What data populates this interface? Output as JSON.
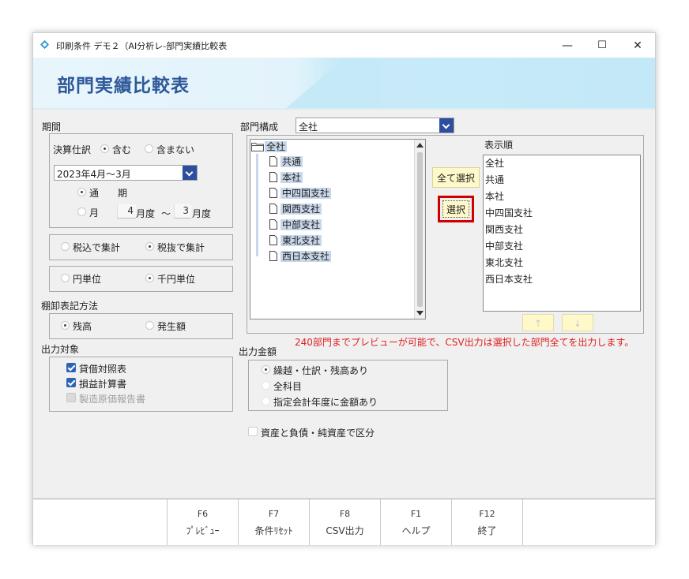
{
  "window": {
    "title": "印刷条件 デモ２（AI分析レ-部門実績比較表",
    "minimize": "—",
    "maximize": "☐",
    "close": "✕"
  },
  "banner": {
    "title": "部門実績比較表"
  },
  "period": {
    "heading": "期間",
    "settlement_label": "決算仕訳",
    "include": "含む",
    "exclude": "含まない",
    "period_value": "2023年4月～3月",
    "mode_full": "通　　期",
    "mode_month": "月",
    "from_month": "4",
    "from_unit": "月度",
    "tilde": "～",
    "to_month": "3",
    "to_unit": "月度"
  },
  "tax": {
    "incl": "税込で集計",
    "excl": "税抜で集計"
  },
  "unit": {
    "yen": "円単位",
    "thousand": "千円単位"
  },
  "inventory": {
    "heading": "棚卸表記方法",
    "balance": "残高",
    "occurrence": "発生額"
  },
  "output_target": {
    "heading": "出力対象",
    "items": [
      "貸借対照表",
      "損益計算書",
      "製造原価報告書"
    ]
  },
  "dept": {
    "label": "部門構成",
    "select_value": "全社",
    "tree_root": "全社",
    "tree_items": [
      "共通",
      "本社",
      "中四国支社",
      "関西支社",
      "中部支社",
      "東北支社",
      "西日本支社"
    ],
    "select_all": "全て選択",
    "select": "選択",
    "order_label": "表示順",
    "order_items": [
      "全社",
      "共通",
      "本社",
      "中四国支社",
      "関西支社",
      "中部支社",
      "東北支社",
      "西日本支社"
    ],
    "up": "↑",
    "down": "↓",
    "notice": "240部門までプレビューが可能で、CSV出力は選択した部門全てを出力します。"
  },
  "amount": {
    "heading": "出力金額",
    "options": [
      "繰越・仕訳・残高あり",
      "全科目",
      "指定会計年度に金額あり"
    ]
  },
  "asset_split": "資産と負債・純資産で区分",
  "fkeys": [
    {
      "key": "F6",
      "name": "ﾌﾟﾚﾋﾞｭｰ"
    },
    {
      "key": "F7",
      "name": "条件ﾘｾｯﾄ"
    },
    {
      "key": "F8",
      "name": "CSV出力"
    },
    {
      "key": "F1",
      "name": "ヘルプ"
    },
    {
      "key": "F12",
      "name": "終了"
    }
  ],
  "colors": {
    "banner_title": "#2e5899",
    "accent": "#2d4e9e",
    "notice": "#e02020",
    "highlight": "#c8d8ea",
    "select_border": "#d10000"
  }
}
